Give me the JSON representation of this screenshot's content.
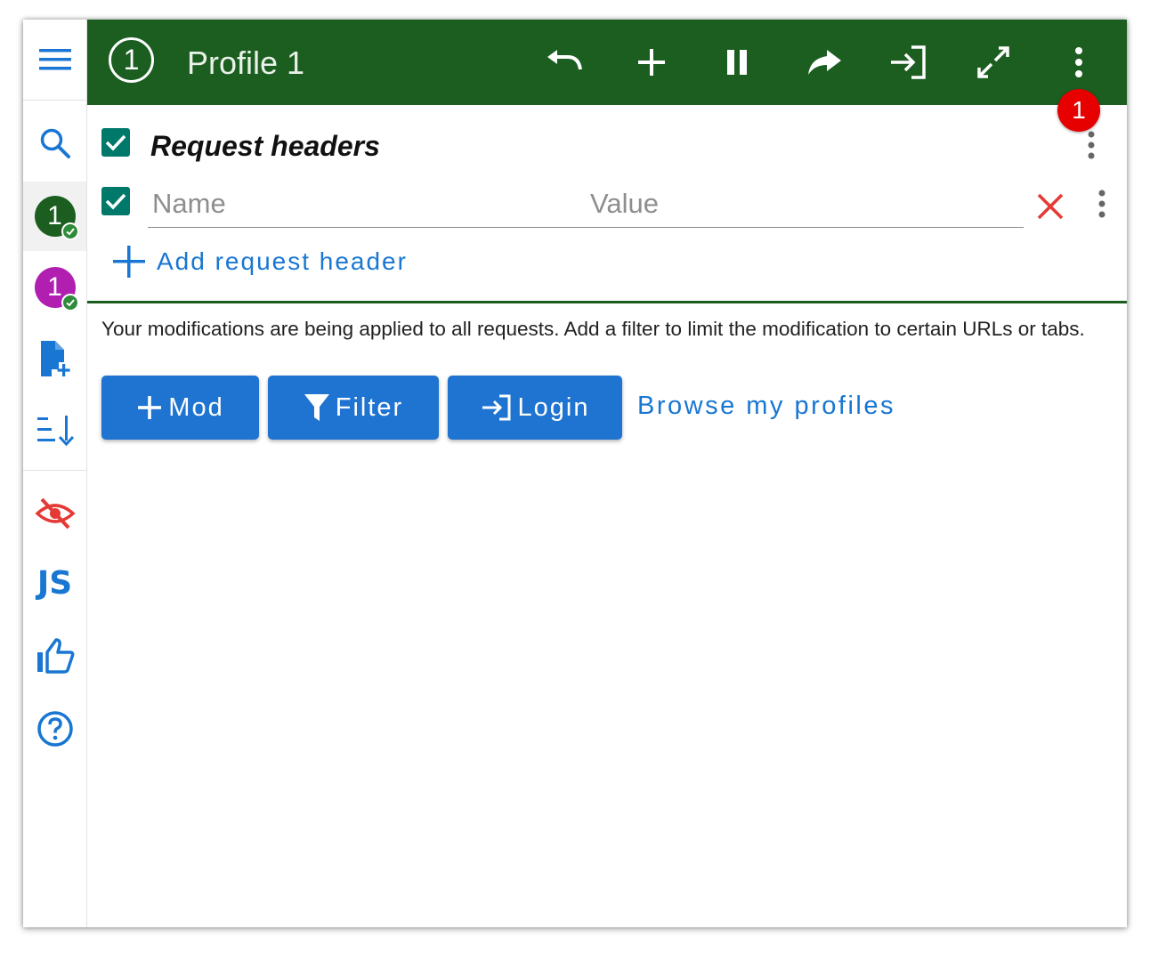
{
  "header": {
    "profile_number": "1",
    "profile_title": "Profile 1",
    "notification_count": "1"
  },
  "sidebar": {
    "profiles": [
      {
        "label": "1",
        "color": "#1b5e20"
      },
      {
        "label": "1",
        "color": "#b01fb0"
      }
    ],
    "js_label": "JS"
  },
  "section": {
    "title": "Request headers",
    "name_placeholder": "Name",
    "value_placeholder": "Value",
    "add_label": "Add request header"
  },
  "info": {
    "text": "Your modifications are being applied to all requests. Add a filter to limit the modification to certain URLs or tabs."
  },
  "actions": {
    "mod_label": "Mod",
    "filter_label": "Filter",
    "login_label": "Login",
    "browse_label": "Browse my profiles"
  },
  "colors": {
    "header_bg": "#1b5e20",
    "accent": "#1976d2",
    "checkbox": "#00796b",
    "badge": "#e60000"
  },
  "icons": [
    "menu-icon",
    "search-icon",
    "add-file-icon",
    "sort-icon",
    "eye-off-icon",
    "thumbs-up-icon",
    "help-icon",
    "undo-icon",
    "plus-icon",
    "pause-icon",
    "redo-icon",
    "login-icon",
    "expand-icon",
    "more-vert-icon",
    "close-icon",
    "filter-icon"
  ]
}
